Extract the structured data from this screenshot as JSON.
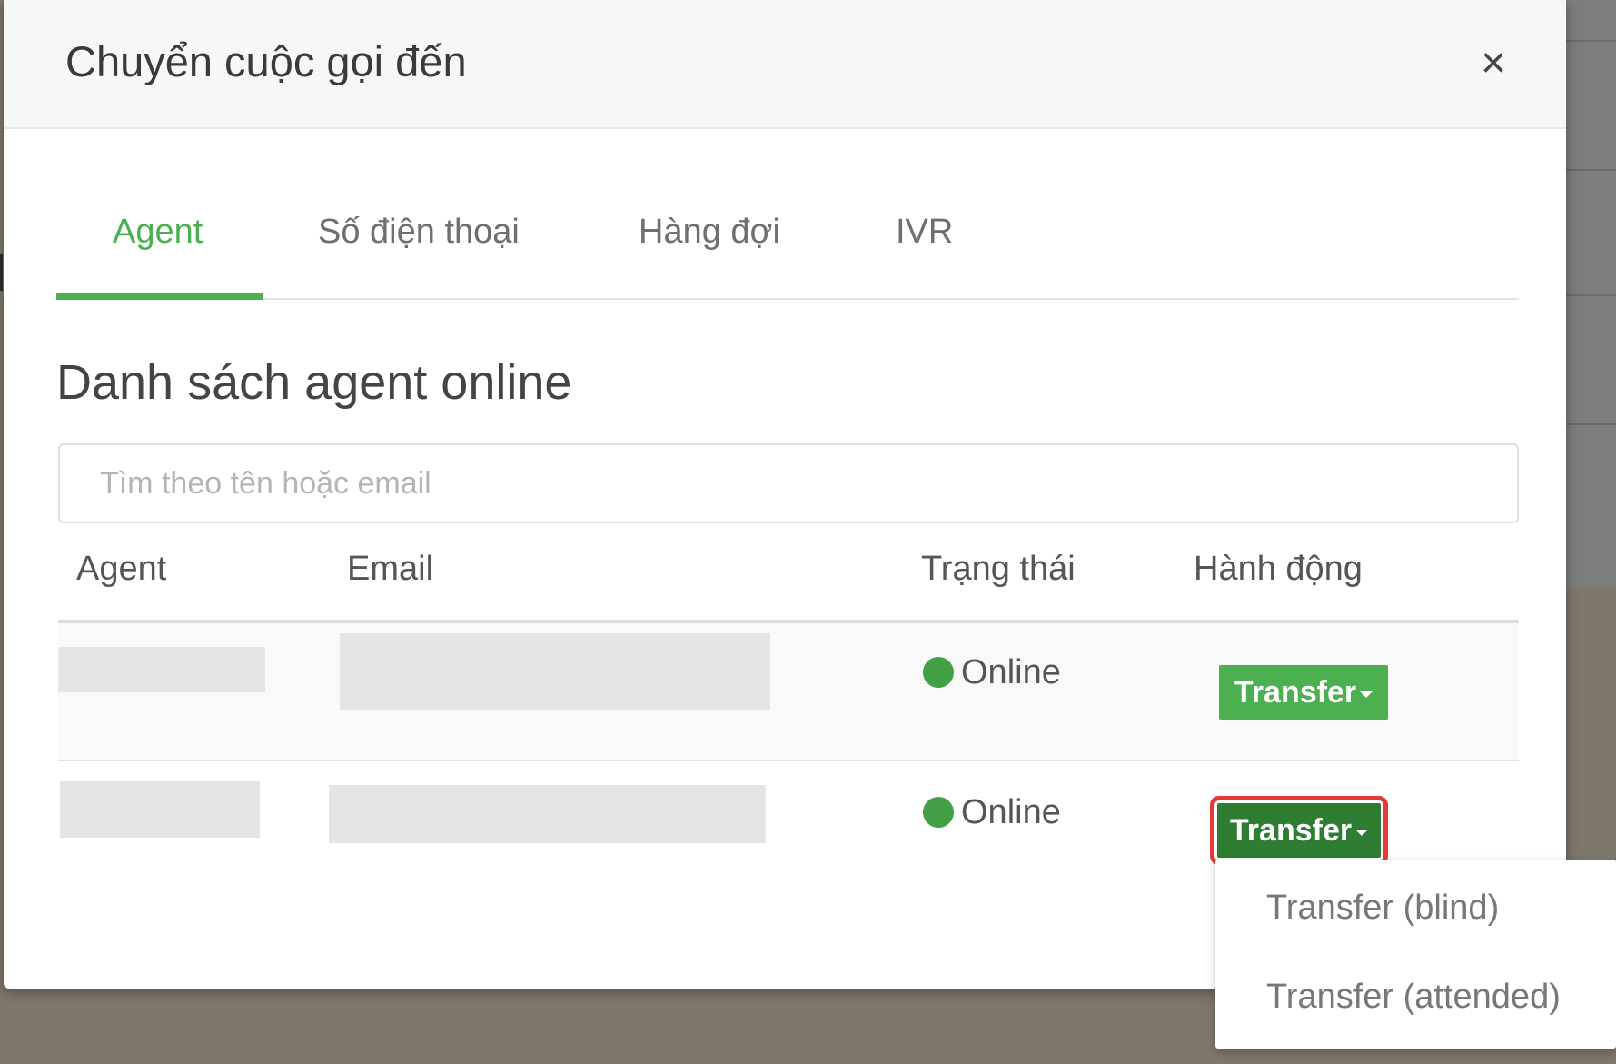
{
  "modal": {
    "title": "Chuyển cuộc gọi đến",
    "close_glyph": "×"
  },
  "tabs": [
    {
      "label": "Agent",
      "active": true
    },
    {
      "label": "Số điện thoại",
      "active": false
    },
    {
      "label": "Hàng đợi",
      "active": false
    },
    {
      "label": "IVR",
      "active": false
    }
  ],
  "section": {
    "title": "Danh sách agent online"
  },
  "search": {
    "placeholder": "Tìm theo tên hoặc email",
    "value": ""
  },
  "table": {
    "headers": [
      "Agent",
      "Email",
      "Trạng thái",
      "Hành động"
    ],
    "rows": [
      {
        "agent": "",
        "email": "",
        "status": "Online",
        "action": "Transfer"
      },
      {
        "agent": "",
        "email": "",
        "status": "Online",
        "action": "Transfer"
      }
    ]
  },
  "dropdown": {
    "items": [
      "Transfer (blind)",
      "Transfer (attended)"
    ]
  },
  "colors": {
    "accent": "#4caf50",
    "online": "#43a047",
    "highlight": "#e53935"
  },
  "icons": {
    "close": "close-icon",
    "status": "status-dot-icon",
    "caret": "caret-down-icon"
  }
}
